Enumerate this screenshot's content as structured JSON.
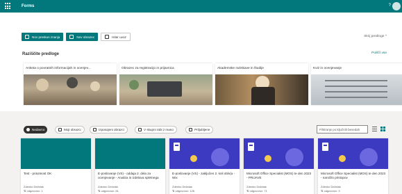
{
  "app": {
    "title": "Forms"
  },
  "header": {
    "help_label": "?"
  },
  "actions": {
    "new_quiz": "Nov preskus znanja",
    "new_form": "Nov obrazec",
    "quick_import": "Hiter uvoz"
  },
  "templates": {
    "hide_label": "Skrij predloge  ^",
    "heading": "Raziščite predloge",
    "explore_more": "Poiščí vse",
    "items": [
      {
        "label": "Anketa o povratnih informacijah in ocenjev..."
      },
      {
        "label": "Obrazec za registracijo in prijavnica"
      },
      {
        "label": "Akademske raziskave in študije"
      },
      {
        "label": "Kviz in ocenjevanje"
      }
    ]
  },
  "filters": {
    "tabs": [
      "Nedavno",
      "Moji obrazci",
      "Izposojeni obrazci",
      "V skupni rabi z mano",
      "Priljubljene"
    ],
    "search_placeholder": "Filtriranje po ključnih besedah"
  },
  "forms": [
    {
      "title": "Test - prisotnost OK",
      "author": "Zdenko Deželak",
      "responses": "⇅ odgovorov: 1"
    },
    {
      "title": "E-poslovanje (VS) - oddaja 2. dela za ocenjevanje - Analiza in izdelava spletnega mest",
      "author": "Zdenko Deželak",
      "responses": "⇅ odgovorov: 81"
    },
    {
      "title": "E-poslovanje (VS) - zaključen 2. koli oblv(a - Wix",
      "author": "Zdenko Deželak",
      "responses": "⇅ odgovorov: 126"
    },
    {
      "title": "Microsoft Office Specialist (MOS) te den 2023 - PRIJAVE",
      "author": "Zdenko Deželak",
      "responses": "⇅ odgovorov: 71"
    },
    {
      "title": "Microsoft Office Specialist (MOS) te den 2023 - naročilo pristopov",
      "author": "Zdenko Deželak",
      "responses": "⇅ odgovorov: 3"
    }
  ],
  "colors": {
    "brand": "#03787c",
    "indigo": "#3d3ac2"
  }
}
